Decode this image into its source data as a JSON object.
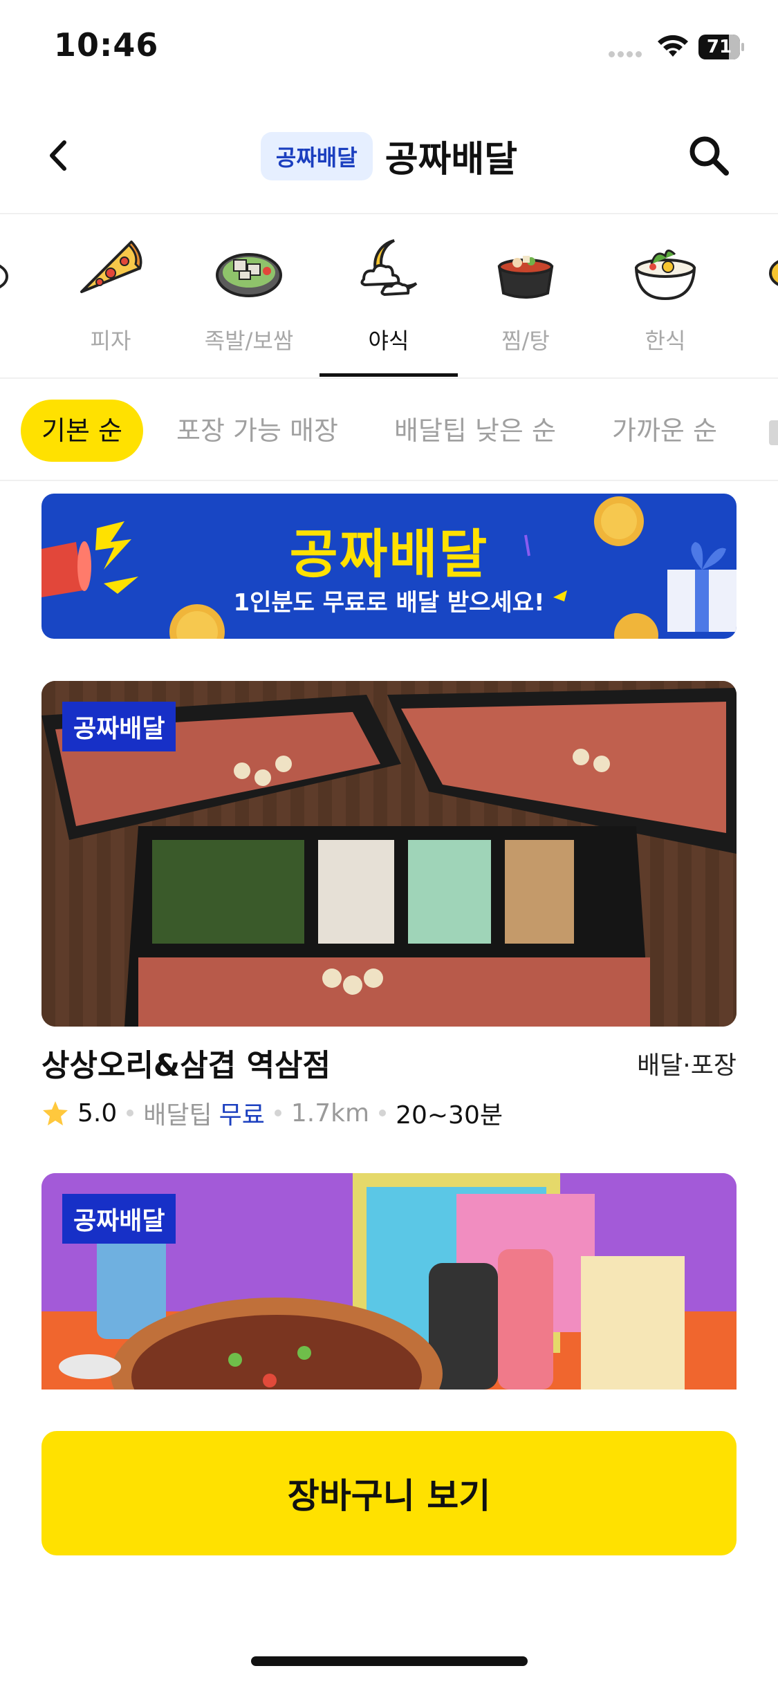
{
  "status_bar": {
    "time": "10:46",
    "battery": "71"
  },
  "header": {
    "badge": "공짜배달",
    "title": "공짜배달"
  },
  "categories": [
    {
      "label": "피자",
      "icon": "pizza-icon"
    },
    {
      "label": "족발/보쌈",
      "icon": "jokbal-icon"
    },
    {
      "label": "야식",
      "icon": "moon-cloud-icon",
      "active": true
    },
    {
      "label": "찜/탕",
      "icon": "stew-pot-icon"
    },
    {
      "label": "한식",
      "icon": "bibimbap-icon"
    }
  ],
  "sort_chips": [
    {
      "label": "기본 순",
      "active": true
    },
    {
      "label": "포장 가능 매장"
    },
    {
      "label": "배달팁 낮은 순"
    },
    {
      "label": "가까운 순"
    }
  ],
  "banner": {
    "title": "공짜배달",
    "subtitle": "1인분도 무료로 배달 받으세요!"
  },
  "stores": [
    {
      "badge": "공짜배달",
      "name": "상상오리&삼겹 역삼점",
      "type": "배달·포장",
      "rating": "5.0",
      "delivery_tip_label": "배달팁",
      "delivery_tip_value": "무료",
      "distance": "1.7km",
      "time": "20~30분"
    },
    {
      "badge": "공짜배달"
    }
  ],
  "cart_button": "장바구니 보기",
  "colors": {
    "accent_yellow": "#ffe100",
    "brand_blue": "#1730c7",
    "tip_blue": "#1b3fbf"
  }
}
